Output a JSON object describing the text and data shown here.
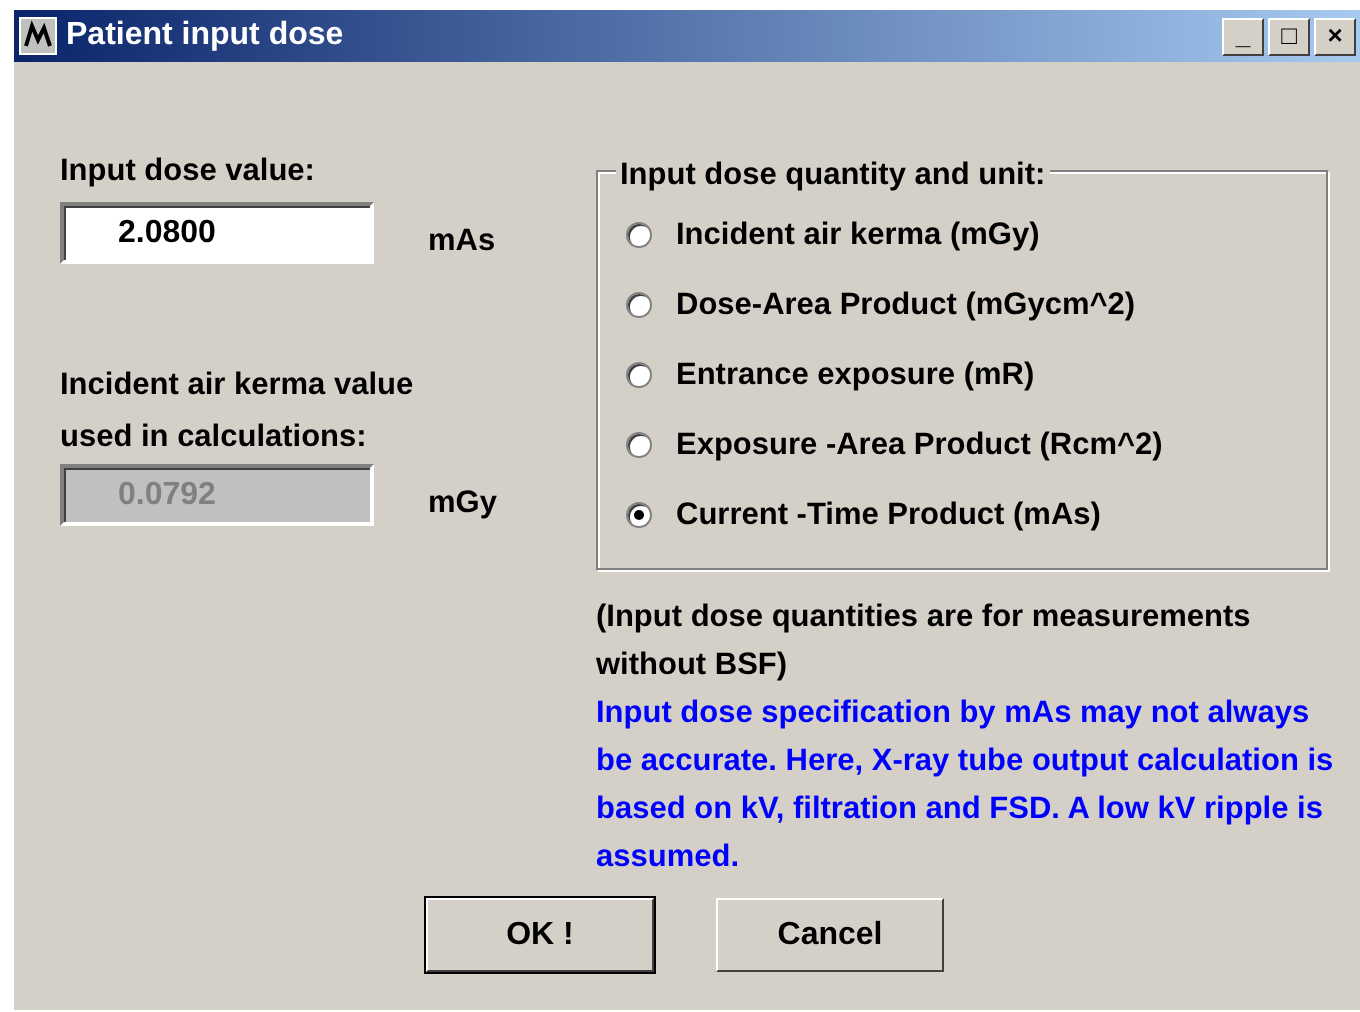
{
  "window": {
    "title": "Patient input dose",
    "controls": [
      "_",
      "□",
      "×"
    ]
  },
  "input_dose": {
    "label": "Input dose value:",
    "value": "2.0800",
    "unit": "mAs"
  },
  "air_kerma": {
    "label": "Incident air kerma value used in calculations:",
    "value": "0.0792",
    "unit": "mGy",
    "disabled": true
  },
  "quantity_group": {
    "title": "Input dose quantity and unit:",
    "options": [
      {
        "label": "Incident air kerma (mGy)",
        "selected": false
      },
      {
        "label": "Dose-Area Product (mGycm^2)",
        "selected": false
      },
      {
        "label": "Entrance exposure (mR)",
        "selected": false
      },
      {
        "label": "Exposure -Area Product (Rcm^2)",
        "selected": false
      },
      {
        "label": "Current -Time Product (mAs)",
        "selected": true
      }
    ]
  },
  "note": "(Input dose quantities are for measurements without BSF)",
  "warning": "Input dose specification by mAs may not always be accurate. Here, X-ray tube output calculation is based on kV, filtration and FSD. A low kV ripple is assumed.",
  "buttons": [
    {
      "label": "OK !",
      "default": true
    },
    {
      "label": "Cancel",
      "default": false
    }
  ]
}
